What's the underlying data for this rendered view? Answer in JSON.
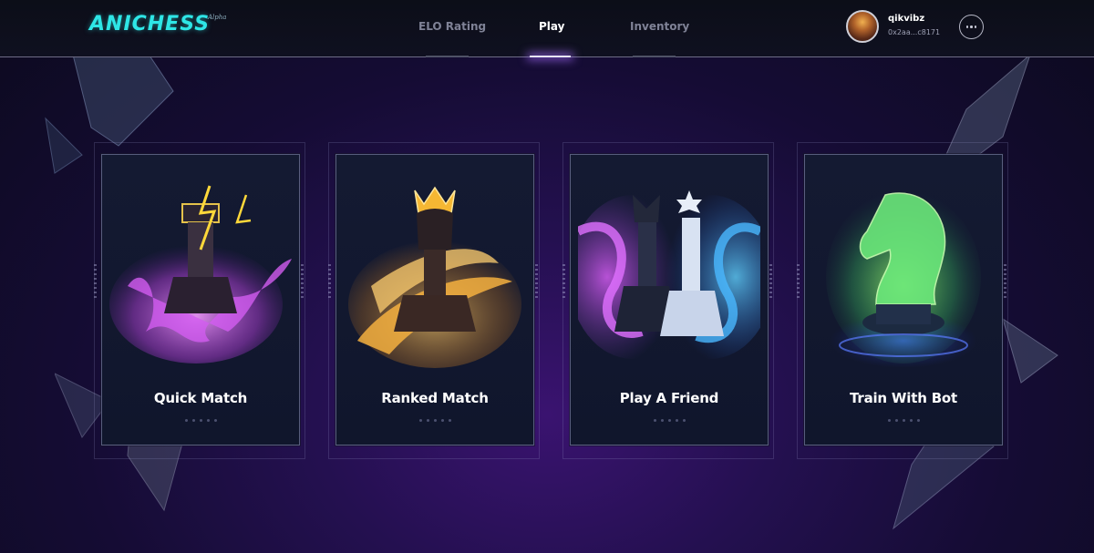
{
  "app": {
    "logo_text": "ANICHESS",
    "logo_tag": "Alpha",
    "accent_color": "#2ee6e6"
  },
  "nav": {
    "items": [
      {
        "label": "ELO Rating",
        "active": false
      },
      {
        "label": "Play",
        "active": true
      },
      {
        "label": "Inventory",
        "active": false
      }
    ]
  },
  "user": {
    "username": "qikvibz",
    "wallet": "0x2aa...c8171",
    "avatar_icon": "avatar-portrait"
  },
  "menu": {
    "more_icon": "ellipsis-icon"
  },
  "cards": [
    {
      "title": "Quick Match",
      "piece_icon": "rook-lightning-icon",
      "glow": "#c04ee8"
    },
    {
      "title": "Ranked Match",
      "piece_icon": "king-crown-icon",
      "glow": "#f2a53a"
    },
    {
      "title": "Play A Friend",
      "piece_icon": "queen-king-pair-icon",
      "glow": "#3aa8ff"
    },
    {
      "title": "Train With Bot",
      "piece_icon": "knight-icon",
      "glow": "#5cf06a"
    }
  ]
}
